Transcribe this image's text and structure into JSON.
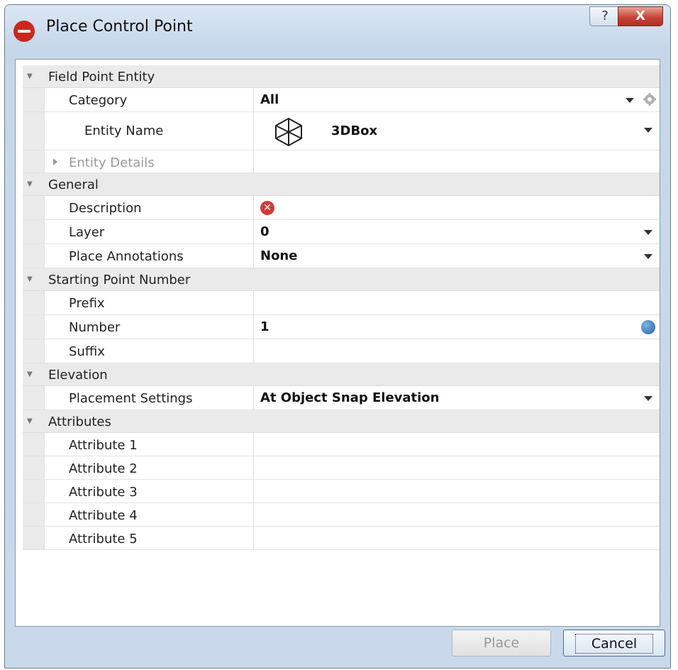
{
  "window": {
    "title": "Place Control Point",
    "help_label": "?",
    "close_label": "X"
  },
  "sections": {
    "field_point_entity": {
      "label": "Field Point Entity",
      "category_label": "Category",
      "category_value": "All",
      "entity_name_label": "Entity Name",
      "entity_name_value": "3DBox",
      "entity_details_label": "Entity Details"
    },
    "general": {
      "label": "General",
      "description_label": "Description",
      "layer_label": "Layer",
      "layer_value": "0",
      "place_annotations_label": "Place Annotations",
      "place_annotations_value": "None"
    },
    "starting_point_number": {
      "label": "Starting Point Number",
      "prefix_label": "Prefix",
      "number_label": "Number",
      "number_value": "1",
      "suffix_label": "Suffix"
    },
    "elevation": {
      "label": "Elevation",
      "placement_settings_label": "Placement Settings",
      "placement_settings_value": "At Object Snap Elevation"
    },
    "attributes": {
      "label": "Attributes",
      "items": [
        "Attribute 1",
        "Attribute 2",
        "Attribute 3",
        "Attribute 4",
        "Attribute 5"
      ]
    }
  },
  "footer": {
    "place_label": "Place",
    "cancel_label": "Cancel"
  },
  "icons": {
    "app": "hilti-logo-icon",
    "entity": "3dbox-icon",
    "description_status": "error-icon",
    "category_settings": "gear-icon",
    "number_tool": "globe-icon"
  }
}
